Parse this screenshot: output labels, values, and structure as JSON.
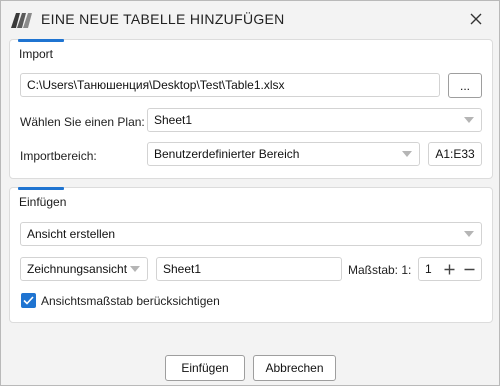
{
  "window": {
    "title": "EINE NEUE TABELLE HINZUFÜGEN",
    "icons": {
      "logo": "app-logo-icon",
      "close": "close-icon"
    }
  },
  "import": {
    "title": "Import",
    "file_path": "C:\\Users\\Танюшенция\\Desktop\\Test\\Table1.xlsx",
    "browse_label": "...",
    "plan_label": "Wählen Sie einen Plan:",
    "plan_value": "Sheet1",
    "range_label": "Importbereich:",
    "range_mode": "Benutzerdefinierter Bereich",
    "range_value": "A1:E33"
  },
  "insert": {
    "title": "Einfügen",
    "action": "Ansicht erstellen",
    "view_type": "Zeichnungsansicht",
    "view_name": "Sheet1",
    "scale_label": "Maßstab: 1:",
    "scale_value": "1",
    "plus": "+",
    "minus": "−",
    "respect_scale_label": "Ansichtsmaßstab berücksichtigen",
    "respect_scale_checked": true
  },
  "footer": {
    "insert_button": "Einfügen",
    "cancel_button": "Abbrechen"
  },
  "colors": {
    "accent": "#1f74d1",
    "background": "#f3f3f3"
  }
}
